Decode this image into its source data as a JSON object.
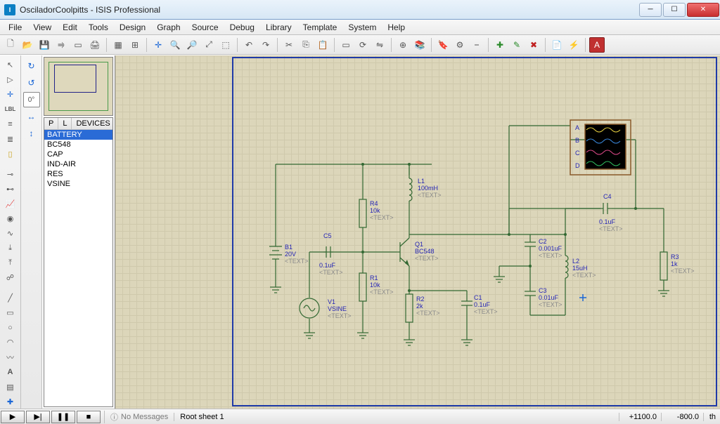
{
  "window": {
    "title": "OsciladorCoolpitts - ISIS Professional",
    "icon_text": "ISIS"
  },
  "menubar": [
    "File",
    "View",
    "Edit",
    "Tools",
    "Design",
    "Graph",
    "Source",
    "Debug",
    "Library",
    "Template",
    "System",
    "Help"
  ],
  "toolbar_icons": [
    "new",
    "open",
    "save",
    "import",
    "page",
    "print",
    "sep",
    "grid",
    "gridconf",
    "sep",
    "origin",
    "zoom-in",
    "zoom-out",
    "zoom-fit",
    "zoom-area",
    "sep",
    "undo",
    "redo",
    "sep",
    "cut",
    "copy",
    "paste",
    "sep",
    "block",
    "rotate",
    "mirror",
    "sep",
    "pick",
    "lib",
    "sep",
    "label",
    "decompose",
    "wire-label",
    "sep",
    "add",
    "add-sheet",
    "delete",
    "sep",
    "bom",
    "erc",
    "sep",
    "ares"
  ],
  "device_list": {
    "header_p": "P",
    "header_l": "L",
    "header_devices": "DEVICES",
    "items": [
      "BATTERY",
      "BC548",
      "CAP",
      "IND-AIR",
      "RES",
      "VSINE"
    ],
    "selected_index": 0
  },
  "angle_value": "0°",
  "schematic": {
    "B1": {
      "ref": "B1",
      "val": "20V",
      "text": "<TEXT>"
    },
    "V1": {
      "ref": "V1",
      "val": "VSINE",
      "text": "<TEXT>"
    },
    "C5": {
      "ref": "C5",
      "val": "0.1uF",
      "text": "<TEXT>"
    },
    "R4": {
      "ref": "R4",
      "val": "10k",
      "text": "<TEXT>"
    },
    "R1": {
      "ref": "R1",
      "val": "10k",
      "text": "<TEXT>"
    },
    "R2": {
      "ref": "R2",
      "val": "2k",
      "text": "<TEXT>"
    },
    "C1": {
      "ref": "C1",
      "val": "0.1uF",
      "text": "<TEXT>"
    },
    "L1": {
      "ref": "L1",
      "val": "100mH",
      "text": "<TEXT>"
    },
    "Q1": {
      "ref": "Q1",
      "val": "BC548",
      "text": "<TEXT>"
    },
    "C2": {
      "ref": "C2",
      "val": "0.001uF",
      "text": "<TEXT>"
    },
    "C3": {
      "ref": "C3",
      "val": "0.01uF",
      "text": "<TEXT>"
    },
    "L2": {
      "ref": "L2",
      "val": "15uH",
      "text": "<TEXT>"
    },
    "C4": {
      "ref": "C4",
      "val": "0.1uF",
      "text": "<TEXT>"
    },
    "R3": {
      "ref": "R3",
      "val": "1k",
      "text": "<TEXT>"
    },
    "scope": {
      "A": "A",
      "B": "B",
      "C": "C",
      "D": "D"
    }
  },
  "status": {
    "messages": "No Messages",
    "sheet": "Root sheet 1",
    "coord_x": "+1100.0",
    "coord_y": "-800.0",
    "coord_unit": "th"
  }
}
